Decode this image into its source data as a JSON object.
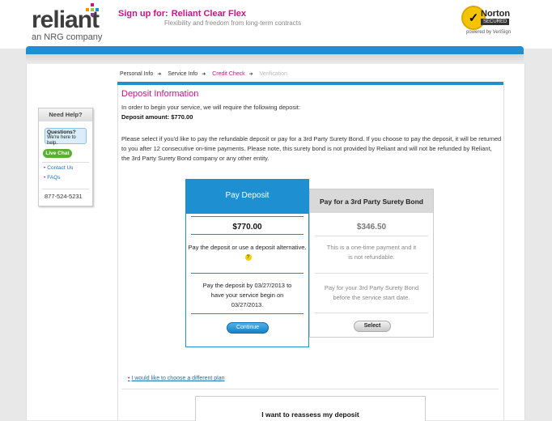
{
  "brand": {
    "name": "reliant",
    "tagline": "an NRG company",
    "colors": {
      "magenta": "#c8158a",
      "blue": "#1e8fd0",
      "green": "#5cae2e"
    }
  },
  "signup": {
    "prefix": "Sign up for:",
    "plan": "Reliant Clear Flex",
    "subtitle": "Flexibility and freedom from long-term contracts"
  },
  "norton": {
    "brand": "Norton",
    "secured": "SECURED",
    "powered": "powered by VeriSign"
  },
  "steps": [
    {
      "label": "Personal Info",
      "state": "done"
    },
    {
      "label": "Service Info",
      "state": "done"
    },
    {
      "label": "Credit Check",
      "state": "active"
    },
    {
      "label": "Verification",
      "state": "future"
    }
  ],
  "deposit": {
    "title": "Deposit Information",
    "intro": "In order to begin your service, we will require the following deposit:",
    "amount_line": "Deposit amount: $770.00",
    "explanation": "Please select if you'd like to pay the refundable deposit or pay for a 3rd Party Surety Bond.  If you choose to pay the deposit, it will be returned to you after 12 consecutive on-time payments. Please note, this surety bond is not provided by Reliant and will not be refunded by Reliant, the 3rd Party Surety Bond company or any other entity."
  },
  "help": {
    "heading": "Need Help?",
    "bubble_title": "Questions?",
    "bubble_text": "We're here to help.",
    "live_chat": "Live Chat",
    "contact": "Contact Us",
    "faqs": "FAQs",
    "phone": "877-524-5231"
  },
  "options": {
    "pay_deposit": {
      "heading": "Pay Deposit",
      "price": "$770.00",
      "desc": "Pay the deposit or use a deposit alternative.",
      "note_1": "Pay the deposit by 03/27/2013 to",
      "note_2": "have your service begin on",
      "note_3": "03/27/2013.",
      "button": "Continue"
    },
    "surety_bond": {
      "heading": "Pay for a 3rd Party Surety Bond",
      "price": "$346.50",
      "desc_1": "This is a one-time payment and it",
      "desc_2": "is not refundable.",
      "note_1": "Pay for your 3rd Party Surety Bond",
      "note_2": "before the service start date.",
      "button": "Select"
    }
  },
  "different_plan": "I would like to choose a different plan",
  "reassess": "I want to reassess my deposit"
}
